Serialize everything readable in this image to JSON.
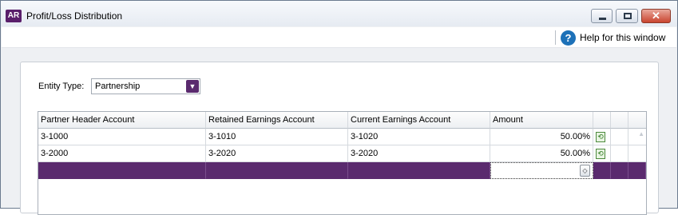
{
  "window": {
    "app_badge": "AR",
    "title": "Profit/Loss Distribution",
    "close_glyph": "✕"
  },
  "help": {
    "icon_glyph": "?",
    "label": "Help for this window"
  },
  "entity": {
    "label": "Entity Type:",
    "value": "Partnership",
    "dropdown_glyph": "▼"
  },
  "grid": {
    "columns": [
      "Partner Header Account",
      "Retained Earnings Account",
      "Current Earnings Account",
      "Amount"
    ],
    "rows": [
      {
        "partner": "3-1000",
        "retained": "3-1010",
        "current": "3-1020",
        "amount": "50.00%"
      },
      {
        "partner": "3-2000",
        "retained": "3-2020",
        "current": "3-2020",
        "amount": "50.00%"
      }
    ],
    "delete_icon": "⟲",
    "spin_glyph": "◇"
  },
  "colors": {
    "accent_purple": "#5a2a6e",
    "help_blue": "#1d71b8",
    "close_red": "#c9442f"
  }
}
